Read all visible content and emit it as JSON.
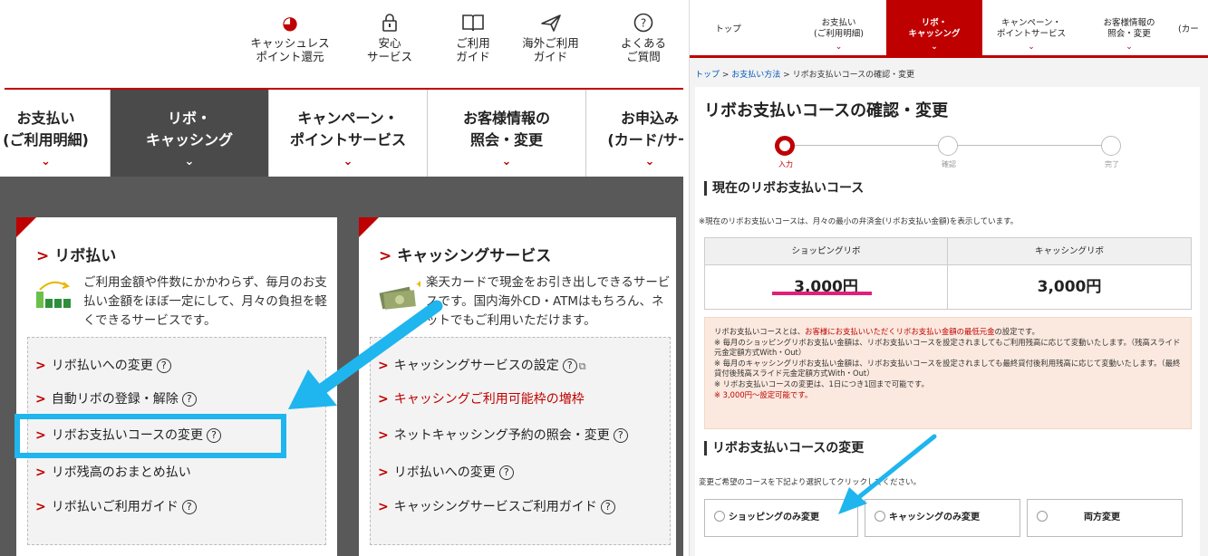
{
  "left": {
    "utility": [
      {
        "icon": "coupon-icon",
        "glyph": "◕",
        "label": "キャッシュレス\nポイント還元"
      },
      {
        "icon": "lock-icon",
        "glyph": "🔒",
        "label": "安心\nサービス"
      },
      {
        "icon": "book-icon",
        "glyph": "🕮",
        "label": "ご利用\nガイド"
      },
      {
        "icon": "plane-icon",
        "glyph": "✈",
        "label": "海外ご利用\nガイド"
      },
      {
        "icon": "question-icon",
        "glyph": "?",
        "label": "よくある\nご質問"
      }
    ],
    "nav": [
      {
        "label": "お支払い\n(ご利用明細)"
      },
      {
        "label": "リボ・\nキャッシング"
      },
      {
        "label": "キャンペーン・\nポイントサービス"
      },
      {
        "label": "お客様情報の\n照会・変更"
      },
      {
        "label": "お申込み\n(カード/サー"
      }
    ],
    "ribo_menu": {
      "heading": "リボ払い",
      "description": "ご利用金額や件数にかかわらず、毎月のお支払い金額をほぼ一定にして、月々の負担を軽くできるサービスです。",
      "items": [
        {
          "label": "リボ払いへの変更"
        },
        {
          "label": "自動リボの登録・解除"
        },
        {
          "label": "リボお支払いコースの変更"
        },
        {
          "label": "リボ残高のおまとめ払い"
        },
        {
          "label": "リボ払いご利用ガイド"
        }
      ]
    },
    "cashing_menu": {
      "heading": "キャッシングサービス",
      "description": "楽天カードで現金をお引き出しできるサービスです。国内海外CD・ATMはもちろん、ネットでもご利用いただけます。",
      "items": [
        {
          "label": "キャッシングサービスの設定"
        },
        {
          "label": "キャッシングご利用可能枠の増枠"
        },
        {
          "label": "ネットキャッシング予約の照会・変更"
        },
        {
          "label": "リボ払いへの変更"
        },
        {
          "label": "キャッシングサービスご利用ガイド"
        }
      ]
    }
  },
  "right": {
    "nav": [
      {
        "label": "トップ"
      },
      {
        "label": "お支払い\n(ご利用明細)"
      },
      {
        "label": "リボ・\nキャッシング"
      },
      {
        "label": "キャンペーン・\nポイントサービス"
      },
      {
        "label": "お客様情報の\n照会・変更"
      },
      {
        "label": "(カー"
      }
    ],
    "breadcrumb": {
      "home": "トップ",
      "sep": " > ",
      "parent": "お支払い方法",
      "current": "リボお支払いコースの確認・変更"
    },
    "title": "リボお支払いコースの確認・変更",
    "steps": [
      "入力",
      "確認",
      "完了"
    ],
    "current_section": "現在のリボお支払いコース",
    "current_note": "※現在のリボお支払いコースは、月々の最小の弁済金(リボお支払い金額)を表示しています。",
    "course_table": {
      "headers": [
        "ショッピングリボ",
        "キャッシングリボ"
      ],
      "values": [
        "3,000円",
        "3,000円"
      ]
    },
    "info": {
      "line1_a": "リボお支払いコースとは、",
      "line1_b": "お客様にお支払いいただくリボお支払い金額の最低元金",
      "line1_c": "の設定です。",
      "line2": "※ 毎月のショッピングリボお支払い金額は、リボお支払いコースを設定されましてもご利用残高に応じて変動いたします。（残高スライド元金定額方式With・Out）",
      "line3": "※ 毎月のキャッシングリボお支払い金額は、リボお支払いコースを設定されましても最終貸付後利用残高に応じて変動いたします。（最終貸付後残高スライド元金定額方式With・Out）",
      "line4": "※ リボお支払いコースの変更は、1日につき1回まで可能です。",
      "line5": "※ 3,000円〜設定可能です。"
    },
    "change_section": "リボお支払いコースの変更",
    "change_note": "変更ご希望のコースを下記より選択してクリックしてください。",
    "options": [
      "ショッピングのみ変更",
      "キャッシングのみ変更",
      "両方変更"
    ]
  },
  "colors": {
    "brand": "#bf0000",
    "highlight": "#1fb5ee",
    "underline": "#e0207a"
  }
}
